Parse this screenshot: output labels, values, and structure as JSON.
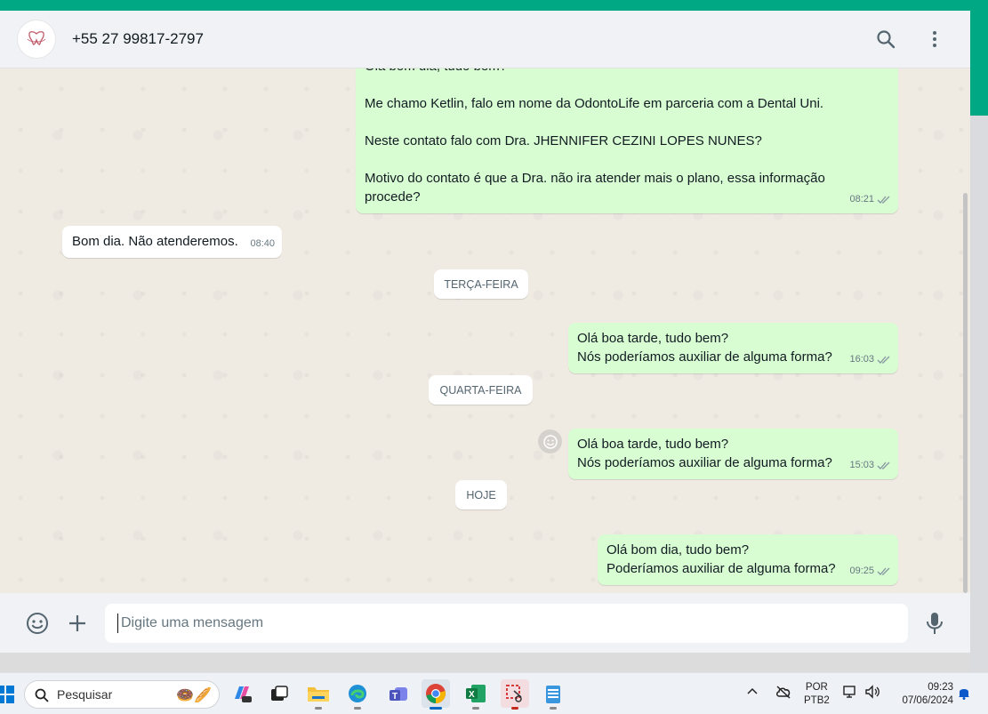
{
  "header": {
    "contact_name": "+55 27 99817-2797"
  },
  "messages": {
    "first": {
      "partial_line": "Olá bom dia, tudo bem?",
      "line1": "Me chamo Ketlin, falo em nome da OdontoLife em parceria com a Dental Uni.",
      "line2": "Neste contato falo com Dra. JHENNIFER CEZINI LOPES NUNES?",
      "line3a": "Motivo do contato é que a Dra. não ira atender mais o plano, essa informação",
      "line3b": "procede?",
      "time": "08:21"
    },
    "reply": {
      "text": "Bom dia. Não atenderemos.",
      "time": "08:40"
    },
    "day1": "TERÇA-FEIRA",
    "second": {
      "line1": "Olá boa tarde, tudo bem?",
      "line2": "Nós poderíamos auxiliar de alguma forma?",
      "time": "16:03"
    },
    "day2": "QUARTA-FEIRA",
    "third": {
      "line1": "Olá boa tarde, tudo bem?",
      "line2": "Nós poderíamos auxiliar de alguma forma?",
      "time": "15:03"
    },
    "day3": "HOJE",
    "fourth": {
      "line1": "Olá bom dia, tudo bem?",
      "line2": "Poderíamos auxiliar de alguma forma?",
      "time": "09:25"
    }
  },
  "composer": {
    "placeholder": "Digite uma mensagem"
  },
  "taskbar": {
    "search_label": "Pesquisar",
    "lang_top": "POR",
    "lang_bottom": "PTB2",
    "time": "09:23",
    "date": "07/06/2024"
  },
  "colors": {
    "accent": "#00a884",
    "outgoing_bubble": "#d9fdd3",
    "incoming_bubble": "#ffffff",
    "chat_background": "#efeae2",
    "read_ticks": "#8696a0"
  },
  "icons": [
    "search-icon",
    "menu-icon",
    "emoji-icon",
    "attach-icon",
    "mic-icon",
    "double-check-icon",
    "react-icon",
    "windows-icon",
    "chrome-icon",
    "excel-icon",
    "teams-icon",
    "edge-icon",
    "bell-icon"
  ]
}
